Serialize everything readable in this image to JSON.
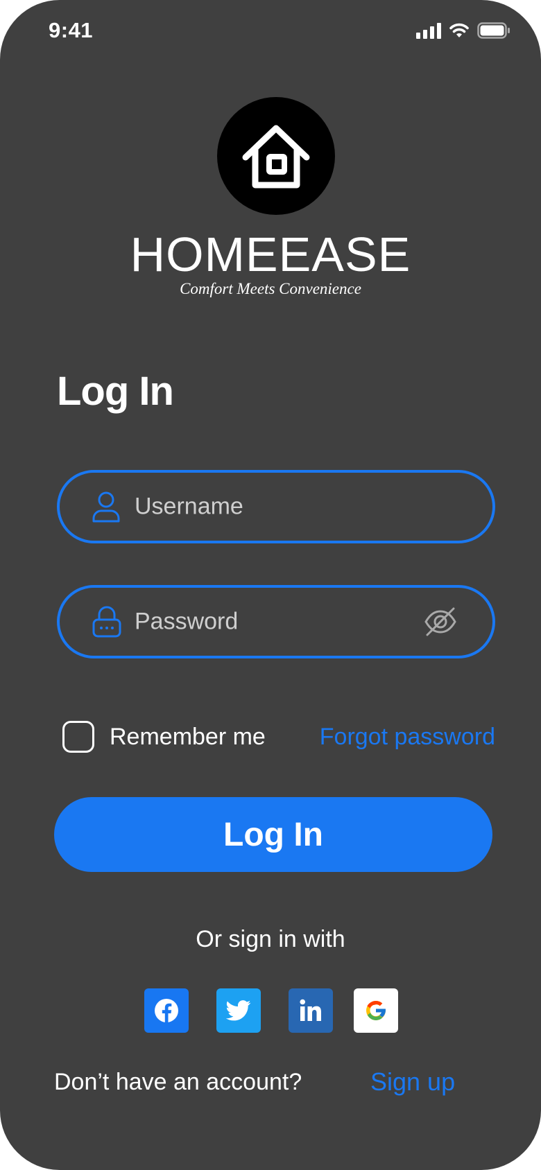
{
  "status_bar": {
    "time": "9:41",
    "icons": [
      "cellular-signal-icon",
      "wifi-icon",
      "battery-icon"
    ]
  },
  "brand": {
    "name": "HOMEEASE",
    "tagline": "Comfort Meets Convenience",
    "logo_icon": "house-icon"
  },
  "form": {
    "heading": "Log In",
    "username": {
      "placeholder": "Username",
      "value": "",
      "icon": "user-icon"
    },
    "password": {
      "placeholder": "Password",
      "value": "",
      "icon": "lock-icon",
      "toggle_icon": "eye-off-icon"
    },
    "remember_label": "Remember me",
    "remember_checked": false,
    "forgot_label": "Forgot password",
    "submit_label": "Log In"
  },
  "social": {
    "label": "Or sign in with",
    "providers": [
      {
        "name": "facebook",
        "icon": "facebook-icon",
        "color": "#1877f2"
      },
      {
        "name": "twitter",
        "icon": "twitter-icon",
        "color": "#1da1f2"
      },
      {
        "name": "linkedin",
        "icon": "linkedin-icon",
        "color": "#2867b2"
      },
      {
        "name": "google",
        "icon": "google-icon",
        "color": "#ffffff"
      }
    ]
  },
  "footer": {
    "prompt": "Don’t have an account?",
    "signup_label": "Sign up"
  },
  "colors": {
    "background": "#404040",
    "accent": "#1a78f2",
    "text": "#ffffff",
    "placeholder": "#cfcfcf"
  }
}
